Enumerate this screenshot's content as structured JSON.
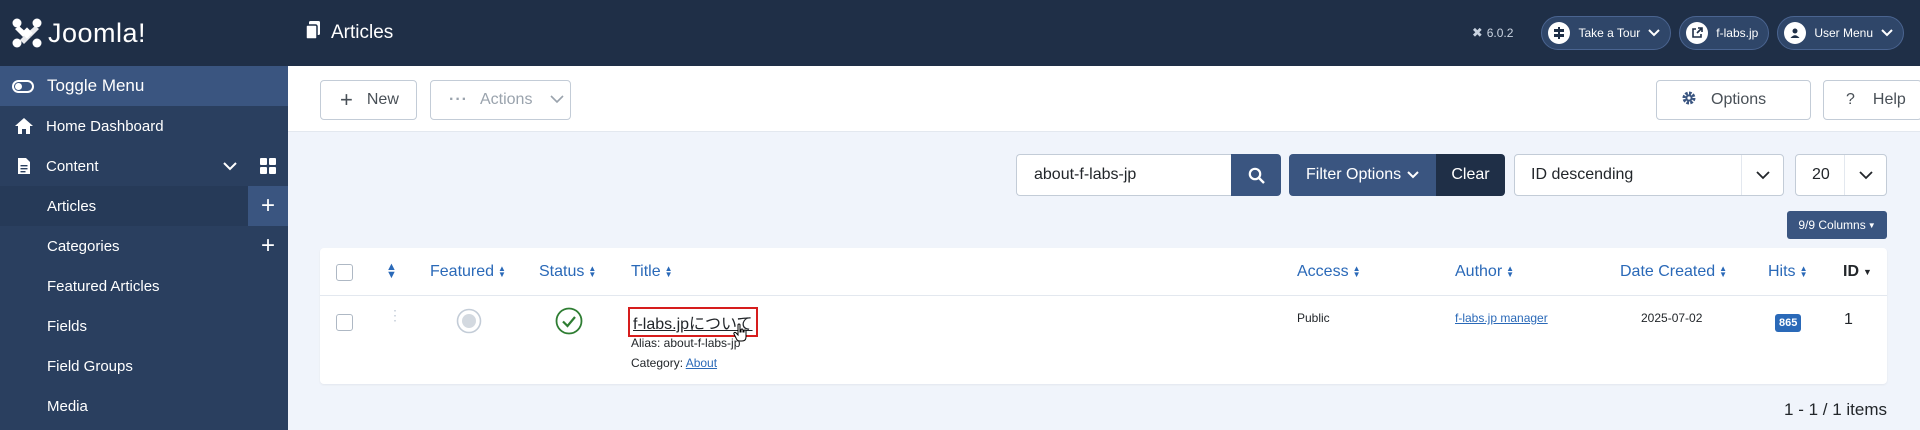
{
  "brand": {
    "name": "Joomla!"
  },
  "sidebar": {
    "toggle_label": "Toggle Menu",
    "items": [
      {
        "label": "Home Dashboard",
        "icon": "home-icon"
      },
      {
        "label": "Content",
        "icon": "file-icon"
      },
      {
        "label": "Articles"
      },
      {
        "label": "Categories"
      },
      {
        "label": "Featured Articles"
      },
      {
        "label": "Fields"
      },
      {
        "label": "Field Groups"
      },
      {
        "label": "Media"
      }
    ]
  },
  "header": {
    "title": "Articles",
    "version": "6.0.2",
    "tour_label": "Take a Tour",
    "site_label": "f-labs.jp",
    "user_menu_label": "User Menu"
  },
  "toolbar": {
    "new_label": "New",
    "actions_label": "Actions",
    "options_label": "Options",
    "help_label": "Help"
  },
  "filters": {
    "search_value": "about-f-labs-jp",
    "filter_options_label": "Filter Options",
    "clear_label": "Clear",
    "sort_value": "ID descending",
    "limit_value": "20",
    "columns_label": "9/9 Columns"
  },
  "table": {
    "headers": {
      "featured": "Featured",
      "status": "Status",
      "title": "Title",
      "access": "Access",
      "author": "Author",
      "date_created": "Date Created",
      "hits": "Hits",
      "id": "ID"
    },
    "rows": [
      {
        "title": "f-labs.jpについて",
        "alias_label": "Alias: about-f-labs-jp",
        "category_prefix": "Category:",
        "category": "About",
        "access": "Public",
        "author": "f-labs.jp manager",
        "date_created": "2025-07-02",
        "hits": "865",
        "id": "1"
      }
    ]
  },
  "pagination": {
    "info": "1 - 1 / 1 items"
  },
  "colors": {
    "header_bg": "#1f2f47",
    "sidebar_bg": "#2a3f5f",
    "accent": "#3a5580",
    "link": "#2a69b8",
    "highlight": "#d61d1d"
  }
}
